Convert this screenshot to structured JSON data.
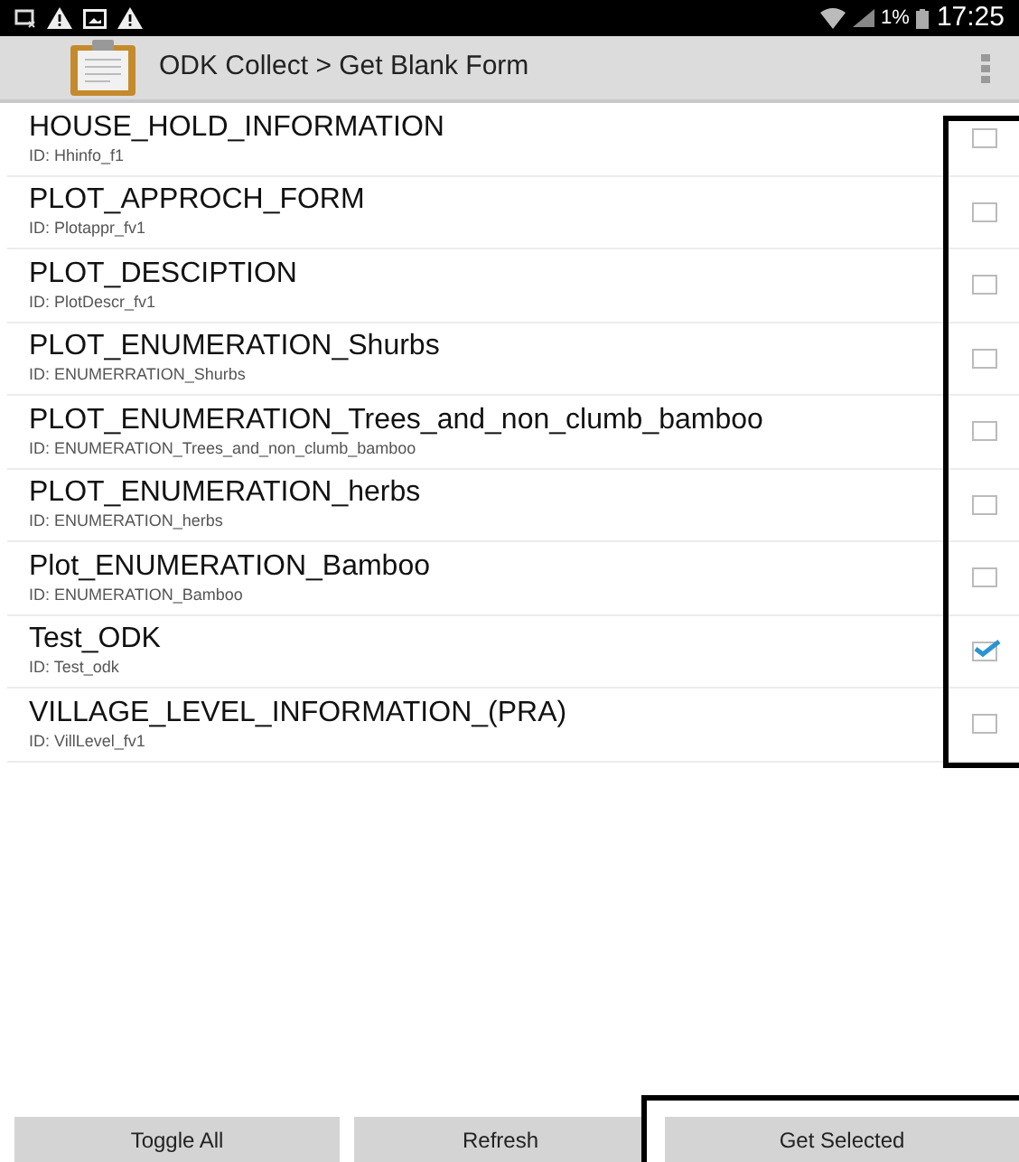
{
  "status_bar": {
    "battery": "1%",
    "time": "17:25"
  },
  "header": {
    "title": "ODK Collect > Get Blank Form"
  },
  "forms": [
    {
      "name": "HOUSE_HOLD_INFORMATION",
      "id": "ID: Hhinfo_f1",
      "checked": false
    },
    {
      "name": "PLOT_APPROCH_FORM",
      "id": "ID: Plotappr_fv1",
      "checked": false
    },
    {
      "name": "PLOT_DESCIPTION",
      "id": "ID: PlotDescr_fv1",
      "checked": false
    },
    {
      "name": "PLOT_ENUMERATION_Shurbs",
      "id": "ID: ENUMERRATION_Shurbs",
      "checked": false
    },
    {
      "name": "PLOT_ENUMERATION_Trees_and_non_clumb_bamboo",
      "id": "ID: ENUMERATION_Trees_and_non_clumb_bamboo",
      "checked": false
    },
    {
      "name": "PLOT_ENUMERATION_herbs",
      "id": "ID: ENUMERATION_herbs",
      "checked": false
    },
    {
      "name": "Plot_ENUMERATION_Bamboo",
      "id": "ID: ENUMERATION_Bamboo",
      "checked": false
    },
    {
      "name": "Test_ODK",
      "id": "ID: Test_odk",
      "checked": true
    },
    {
      "name": "VILLAGE_LEVEL_INFORMATION_(PRA)",
      "id": "ID: VillLevel_fv1",
      "checked": false
    }
  ],
  "buttons": [
    "Toggle All",
    "Refresh",
    "Get Selected"
  ]
}
